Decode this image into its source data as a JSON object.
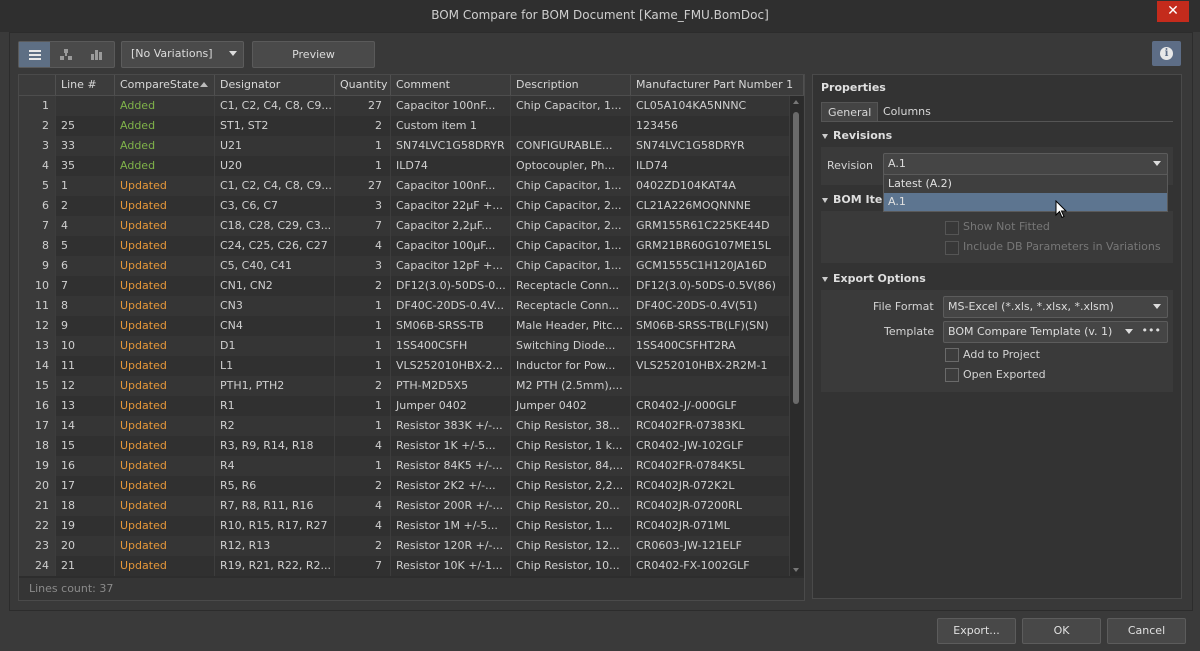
{
  "window": {
    "title": "BOM Compare for BOM Document [Kame_FMU.BomDoc]",
    "close_glyph": "✕"
  },
  "toolbar": {
    "variations": "[No Variations]",
    "preview": "Preview",
    "view_icons": [
      "list-view-icon",
      "tree-view-icon",
      "chart-view-icon"
    ]
  },
  "grid": {
    "columns": [
      "",
      "Line #",
      "CompareState",
      "Designator",
      "Quantity",
      "Comment",
      "Description",
      "Manufacturer Part Number 1"
    ],
    "rows": [
      {
        "idx": "1",
        "line": "",
        "state": "Added",
        "designator": "C1, C2, C4, C8, C9...",
        "qty": "27",
        "comment": "Capacitor 100nF...",
        "description": "Chip Capacitor, 1...",
        "mpn": "CL05A104KA5NNNC"
      },
      {
        "idx": "2",
        "line": "25",
        "state": "Added",
        "designator": "ST1, ST2",
        "qty": "2",
        "comment": "Custom item 1",
        "description": "",
        "mpn": "123456"
      },
      {
        "idx": "3",
        "line": "33",
        "state": "Added",
        "designator": "U21",
        "qty": "1",
        "comment": "SN74LVC1G58DRYR",
        "description": "CONFIGURABLE...",
        "mpn": "SN74LVC1G58DRYR"
      },
      {
        "idx": "4",
        "line": "35",
        "state": "Added",
        "designator": "U20",
        "qty": "1",
        "comment": "ILD74",
        "description": "Optocoupler, Ph...",
        "mpn": "ILD74"
      },
      {
        "idx": "5",
        "line": "1",
        "state": "Updated",
        "designator": "C1, C2, C4, C8, C9...",
        "qty": "27",
        "comment": "Capacitor 100nF...",
        "description": "Chip Capacitor, 1...",
        "mpn": "0402ZD104KAT4A"
      },
      {
        "idx": "6",
        "line": "2",
        "state": "Updated",
        "designator": "C3, C6, C7",
        "qty": "3",
        "comment": "Capacitor 22µF +...",
        "description": "Chip Capacitor, 2...",
        "mpn": "CL21A226MOQNNNE"
      },
      {
        "idx": "7",
        "line": "4",
        "state": "Updated",
        "designator": "C18, C28, C29, C3...",
        "qty": "7",
        "comment": "Capacitor 2,2µF...",
        "description": "Chip Capacitor, 2...",
        "mpn": "GRM155R61C225KE44D"
      },
      {
        "idx": "8",
        "line": "5",
        "state": "Updated",
        "designator": "C24, C25, C26, C27",
        "qty": "4",
        "comment": "Capacitor 100µF...",
        "description": "Chip Capacitor, 1...",
        "mpn": "GRM21BR60G107ME15L"
      },
      {
        "idx": "9",
        "line": "6",
        "state": "Updated",
        "designator": "C5, C40, C41",
        "qty": "3",
        "comment": "Capacitor 12pF +...",
        "description": "Chip Capacitor, 1...",
        "mpn": "GCM1555C1H120JA16D"
      },
      {
        "idx": "10",
        "line": "7",
        "state": "Updated",
        "designator": "CN1, CN2",
        "qty": "2",
        "comment": "DF12(3.0)-50DS-0...",
        "description": "Receptacle Conn...",
        "mpn": "DF12(3.0)-50DS-0.5V(86)"
      },
      {
        "idx": "11",
        "line": "8",
        "state": "Updated",
        "designator": "CN3",
        "qty": "1",
        "comment": "DF40C-20DS-0.4V...",
        "description": "Receptacle Conn...",
        "mpn": "DF40C-20DS-0.4V(51)"
      },
      {
        "idx": "12",
        "line": "9",
        "state": "Updated",
        "designator": "CN4",
        "qty": "1",
        "comment": "SM06B-SRSS-TB",
        "description": "Male Header, Pitc...",
        "mpn": "SM06B-SRSS-TB(LF)(SN)"
      },
      {
        "idx": "13",
        "line": "10",
        "state": "Updated",
        "designator": "D1",
        "qty": "1",
        "comment": "1SS400CSFH",
        "description": "Switching Diode...",
        "mpn": "1SS400CSFHT2RA"
      },
      {
        "idx": "14",
        "line": "11",
        "state": "Updated",
        "designator": "L1",
        "qty": "1",
        "comment": "VLS252010HBX-2...",
        "description": "Inductor for Pow...",
        "mpn": "VLS252010HBX-2R2M-1"
      },
      {
        "idx": "15",
        "line": "12",
        "state": "Updated",
        "designator": "PTH1, PTH2",
        "qty": "2",
        "comment": "PTH-M2D5X5",
        "description": "M2 PTH (2.5mm),...",
        "mpn": ""
      },
      {
        "idx": "16",
        "line": "13",
        "state": "Updated",
        "designator": "R1",
        "qty": "1",
        "comment": "Jumper 0402",
        "description": "Jumper 0402",
        "mpn": "CR0402-J/-000GLF"
      },
      {
        "idx": "17",
        "line": "14",
        "state": "Updated",
        "designator": "R2",
        "qty": "1",
        "comment": "Resistor 383K +/-...",
        "description": "Chip Resistor, 38...",
        "mpn": "RC0402FR-07383KL"
      },
      {
        "idx": "18",
        "line": "15",
        "state": "Updated",
        "designator": "R3, R9, R14, R18",
        "qty": "4",
        "comment": "Resistor 1K +/-5...",
        "description": "Chip Resistor, 1 k...",
        "mpn": "CR0402-JW-102GLF"
      },
      {
        "idx": "19",
        "line": "16",
        "state": "Updated",
        "designator": "R4",
        "qty": "1",
        "comment": "Resistor 84K5 +/-...",
        "description": "Chip Resistor, 84,...",
        "mpn": "RC0402FR-0784K5L"
      },
      {
        "idx": "20",
        "line": "17",
        "state": "Updated",
        "designator": "R5, R6",
        "qty": "2",
        "comment": "Resistor 2K2 +/-...",
        "description": "Chip Resistor, 2,2...",
        "mpn": "RC0402JR-072K2L"
      },
      {
        "idx": "21",
        "line": "18",
        "state": "Updated",
        "designator": "R7, R8, R11, R16",
        "qty": "4",
        "comment": "Resistor 200R +/-...",
        "description": "Chip Resistor, 20...",
        "mpn": "RC0402JR-07200RL"
      },
      {
        "idx": "22",
        "line": "19",
        "state": "Updated",
        "designator": "R10, R15, R17, R27",
        "qty": "4",
        "comment": "Resistor 1M +/-5...",
        "description": "Chip Resistor, 1...",
        "mpn": "RC0402JR-071ML"
      },
      {
        "idx": "23",
        "line": "20",
        "state": "Updated",
        "designator": "R12, R13",
        "qty": "2",
        "comment": "Resistor 120R +/-...",
        "description": "Chip Resistor, 12...",
        "mpn": "CR0603-JW-121ELF"
      },
      {
        "idx": "24",
        "line": "21",
        "state": "Updated",
        "designator": "R19, R21, R22, R2...",
        "qty": "7",
        "comment": "Resistor 10K +/-1...",
        "description": "Chip Resistor, 10...",
        "mpn": "CR0402-FX-1002GLF"
      }
    ],
    "status": "Lines count: 37"
  },
  "properties": {
    "title": "Properties",
    "tabs": [
      "General",
      "Columns"
    ],
    "revisions": {
      "header": "Revisions",
      "label": "Revision",
      "value": "A.1",
      "options": [
        "Latest (A.2)",
        "A.1"
      ]
    },
    "bom_items": {
      "header": "BOM Item",
      "show_not_fitted": "Show Not Fitted",
      "include_db": "Include DB Parameters in Variations"
    },
    "export": {
      "header": "Export Options",
      "file_format_label": "File Format",
      "file_format_value": "MS-Excel (*.xls, *.xlsx, *.xlsm)",
      "template_label": "Template",
      "template_value": "BOM Compare Template (v. 1)",
      "template_more": "•••",
      "add_to_project": "Add to Project",
      "open_exported": "Open Exported"
    }
  },
  "footer": {
    "export": "Export...",
    "ok": "OK",
    "cancel": "Cancel"
  },
  "colors": {
    "added": "#7fb24a",
    "updated": "#e5973a",
    "accent": "#5d6d86",
    "close": "#c42b1c"
  }
}
